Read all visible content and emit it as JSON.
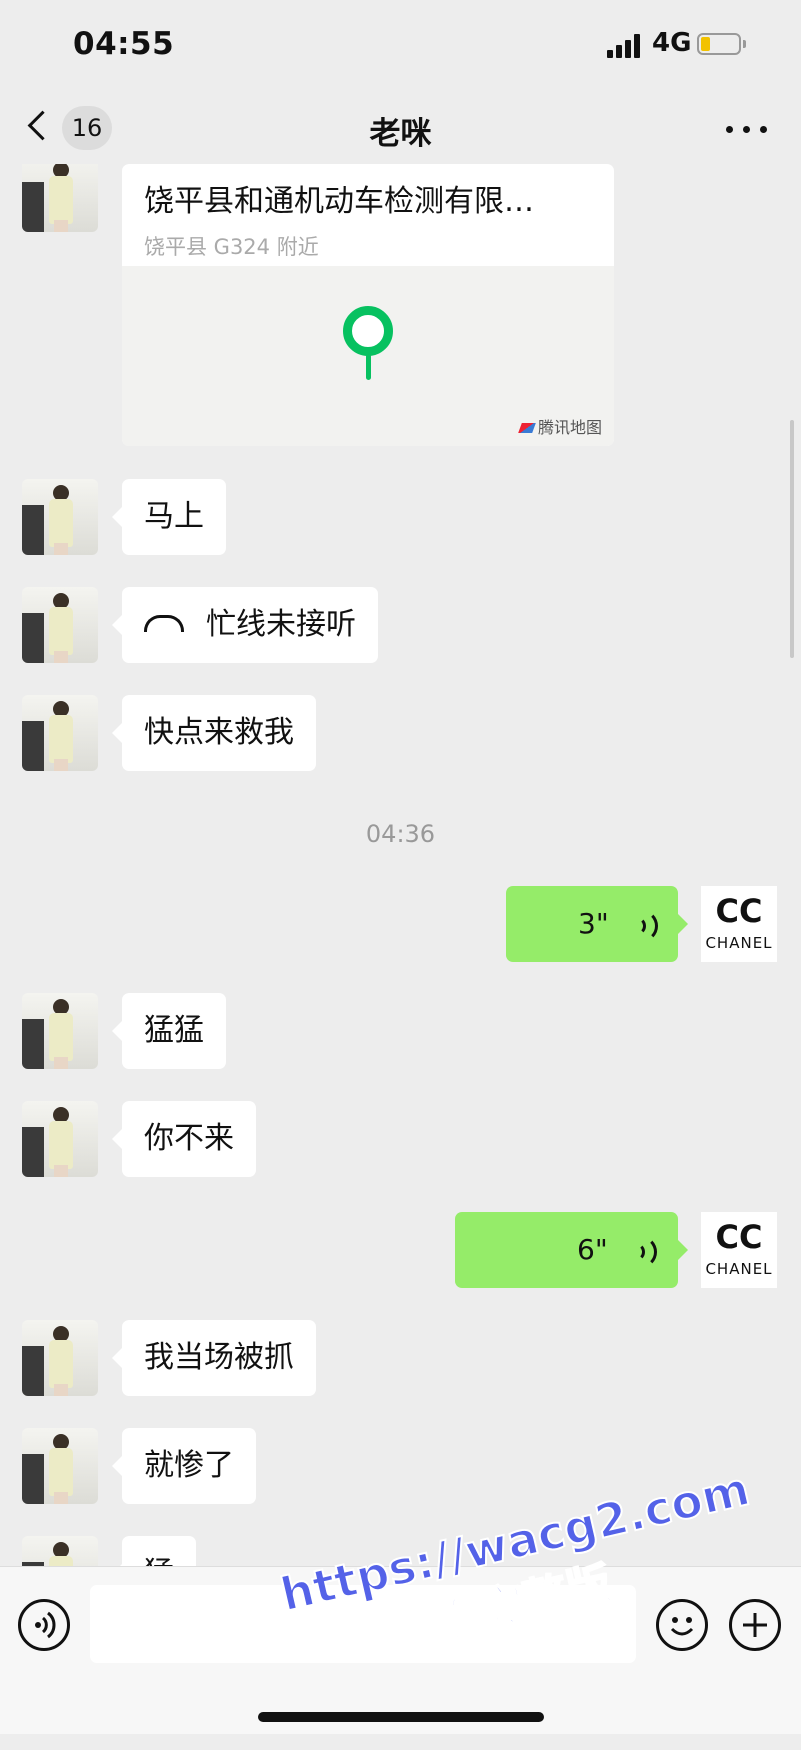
{
  "status_bar": {
    "time": "04:55",
    "network": "4G",
    "battery_percent": 20
  },
  "nav": {
    "back_badge": "16",
    "title": "老咪"
  },
  "location": {
    "title": "饶平县和通机动车检测有限…",
    "address": "饶平县 G324 附近",
    "map_provider": "腾讯地图"
  },
  "messages": {
    "m1": "马上",
    "m2": "忙线未接听",
    "m3": "快点来救我",
    "time": "04:36",
    "v1": "3\"",
    "m4": "猛猛",
    "m5": "你不来",
    "v2": "6\"",
    "m6": "我当场被抓",
    "m7": "就惨了",
    "m8": "猛"
  },
  "self_avatar": {
    "logo": "CC",
    "brand": "CHANEL"
  },
  "input": {
    "value": ""
  },
  "watermark": {
    "url": "https://wacg2.com",
    "text": "看完整版"
  },
  "icons": {
    "call": "phone-hangup-icon",
    "voice": "voice-wave-icon",
    "pin": "map-pin-icon",
    "emoji": "smiley-icon",
    "plus": "plus-icon",
    "voice_toggle": "voice-input-icon"
  }
}
